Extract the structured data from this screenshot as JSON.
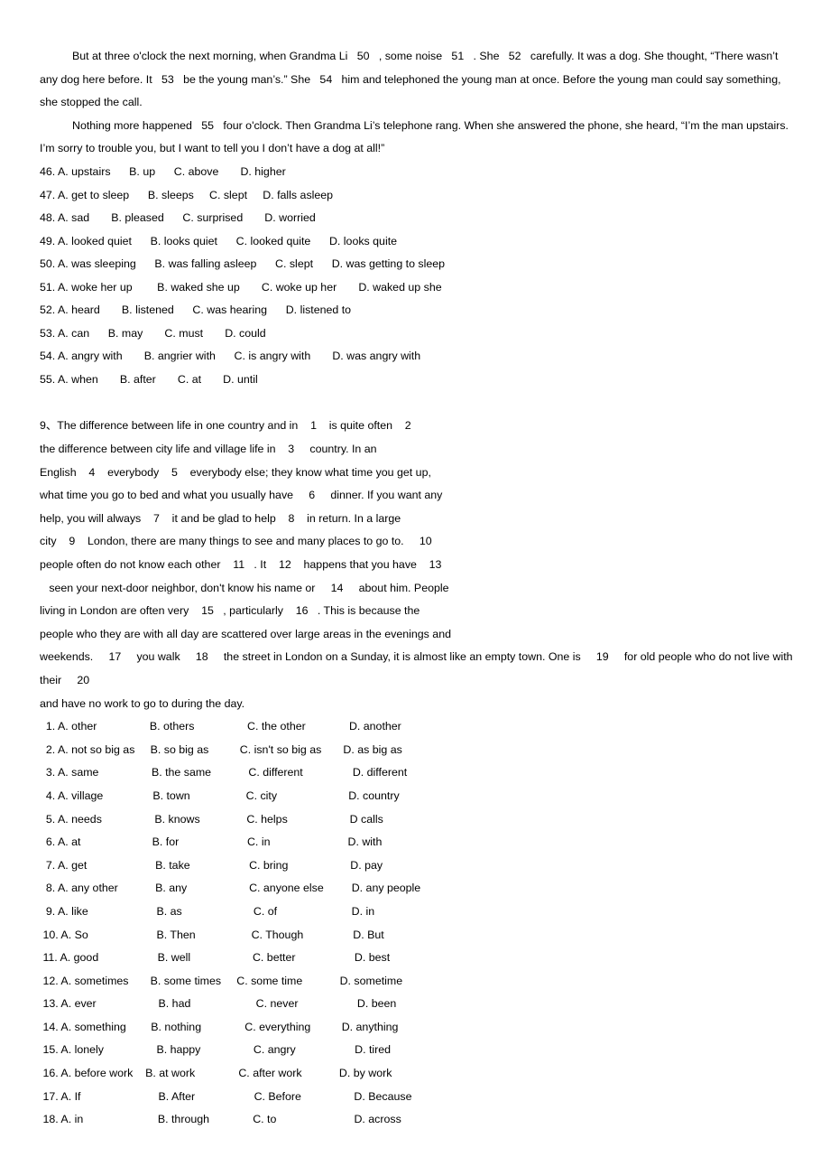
{
  "document": {
    "passage1": {
      "paragraphs": [
        "But at three o'clock the next morning, when Grandma Li   50   , some noise   51   . She   52   carefully. It was a dog. She thought, “There wasn’t any dog here before. It   53   be the young man’s.” She   54   him and telephoned the young man at once. Before the young man could say something, she stopped the call.",
        "Nothing more happened   55   four o'clock. Then Grandma Li’s telephone rang. When she answered the phone, she heard, “I’m the man upstairs. I’m sorry to trouble you, but I want to tell you I don’t have a dog at all!”"
      ],
      "options": [
        "46. A. upstairs      B. up      C. above       D. higher",
        "47. A. get to sleep      B. sleeps     C. slept     D. falls asleep",
        "48. A. sad       B. pleased      C. surprised       D. worried",
        "49. A. looked quiet      B. looks quiet      C. looked quite      D. looks quite",
        "50. A. was sleeping      B. was falling asleep      C. slept      D. was getting to sleep",
        "51. A. woke her up        B. waked she up       C. woke up her       D. waked up she",
        "52. A. heard       B. listened      C. was hearing      D. listened to",
        "53. A. can      B. may       C. must       D. could",
        "54. A. angry with       B. angrier with      C. is angry with       D. was angry with",
        "55. A. when       B. after       C. at       D. until"
      ]
    },
    "passage2": {
      "lines": [
        "9、The difference between life in one country and in    1    is quite often    2",
        "the difference between city life and village life in    3     country. In an",
        "English    4    everybody    5    everybody else; they know what time you get up,",
        "what time you go to bed and what you usually have     6     dinner. If you want any",
        "help, you will always    7    it and be glad to help    8    in return. In a large",
        "city    9    London, there are many things to see and many places to go to.     10",
        "people often do not know each other    11   . It    12    happens that you have    13",
        "   seen your next-door neighbor, don't know his name or     14     about him. People",
        "living in London are often very    15   , particularly    16   . This is because the",
        "people who they are with all day are scattered over large areas in the evenings and"
      ],
      "wrapped_line": "weekends.     17     you walk     18     the street in London on a Sunday, it is almost like an empty town. One is     19     for old people who do not live with their     20",
      "final_line": "and have no work to go to during the day.",
      "options": [
        "  1. A. other                 B. others                 C. the other              D. another",
        "  2. A. not so big as     B. so big as          C. isn't so big as       D. as big as",
        "  3. A. same                 B. the same            C. different                D. different",
        "  4. A. village                B. town                  C. city                       D. country",
        "  5. A. needs                 B. knows               C. helps                    D calls",
        "  6. A. at                       B. for                      C. in                         D. with",
        "  7. A. get                      B. take                   C. bring                    D. pay",
        "  8. A. any other            B. any                    C. anyone else         D. any people",
        "  9. A. like                      B. as                       C. of                        D. in",
        " 10. A. So                      B. Then                  C. Though                D. But",
        " 11. A. good                   B. well                    C. better                   D. best",
        " 12. A. sometimes       B. some times     C. some time            D. sometime",
        " 13. A. ever                    B. had                     C. never                   D. been",
        " 14. A. something        B. nothing              C. everything          D. anything",
        " 15. A. lonely                 B. happy                 C. angry                   D. tired",
        " 16. A. before work    B. at work              C. after work            D. by work",
        " 17. A. If                         B. After                   C. Before                 D. Because",
        " 18. A. in                        B. through              C. to                         D. across"
      ]
    }
  }
}
